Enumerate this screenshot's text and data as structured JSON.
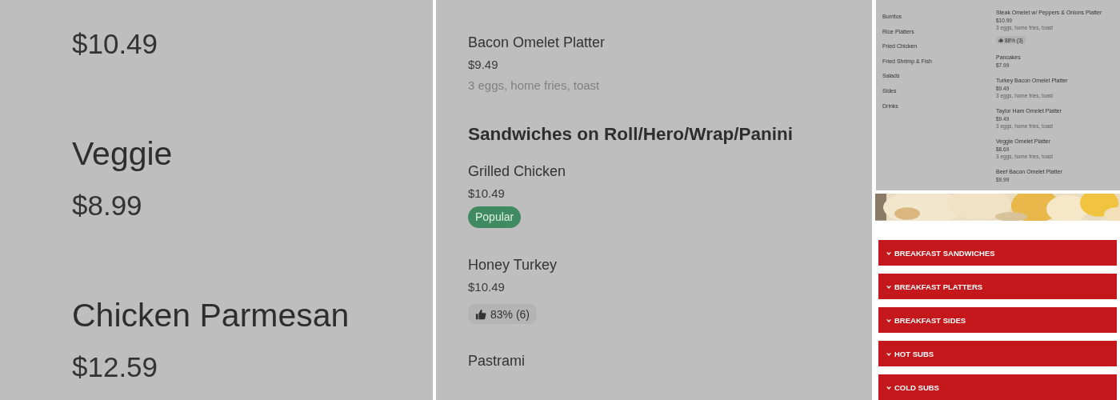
{
  "left_panel": {
    "items": [
      {
        "price": "$10.49"
      },
      {
        "name": "Veggie",
        "price": "$8.99"
      },
      {
        "name": "Chicken Parmesan",
        "price": "$12.59"
      }
    ]
  },
  "middle_panel": {
    "entries": [
      {
        "kind": "item",
        "name": "Bacon Omelet Platter",
        "price": "$9.49",
        "description": "3 eggs, home fries, toast"
      },
      {
        "kind": "heading",
        "title": "Sandwiches on Roll/Hero/Wrap/Panini"
      },
      {
        "kind": "item",
        "name": "Grilled Chicken",
        "price": "$10.49",
        "badge": "Popular"
      },
      {
        "kind": "item",
        "name": "Honey Turkey",
        "price": "$10.49",
        "rating": "83% (6)"
      },
      {
        "kind": "item",
        "name": "Pastrami"
      }
    ]
  },
  "right_panel": {
    "categories": [
      "Burritos",
      "Rice Platters",
      "Fried Chicken",
      "Fried Shrimp & Fish",
      "Salads",
      "Sides",
      "Drinks"
    ],
    "items": [
      {
        "name": "Steak Omelet w/ Peppers & Onions Platter",
        "price": "$10.99",
        "description": "3 eggs, home fries, toast",
        "rating": "88% (3)"
      },
      {
        "name": "Pancakes",
        "price": "$7.99"
      },
      {
        "name": "Turkey Bacon Omelet Platter",
        "price": "$9.49",
        "description": "3 eggs, home fries, toast"
      },
      {
        "name": "Taylor Ham Omelet Platter",
        "price": "$9.49",
        "description": "3 eggs, home fries, toast"
      },
      {
        "name": "Veggie Omelet Platter",
        "price": "$8.69",
        "description": "3 eggs, home fries, toast"
      },
      {
        "name": "Beef Bacon Omelet Platter",
        "price": "$9.99"
      }
    ],
    "sections": [
      {
        "label": "BREAKFAST SANDWICHES",
        "expanded": false
      },
      {
        "label": "BREAKFAST PLATTERS",
        "expanded": false
      },
      {
        "label": "BREAKFAST SIDES",
        "expanded": false
      },
      {
        "label": "HOT SUBS",
        "expanded": false
      },
      {
        "label": "COLD SUBS",
        "expanded": false
      }
    ]
  }
}
